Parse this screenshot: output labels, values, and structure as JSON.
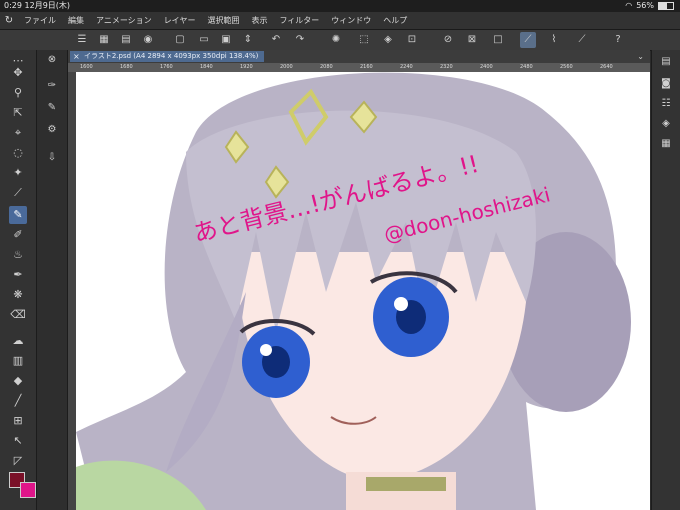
{
  "status": {
    "time": "0:29",
    "date": "12月9日(木)",
    "battery": "56%",
    "wifi_icon": "wifi-icon",
    "battery_icon": "battery-icon"
  },
  "menu": [
    "ファイル",
    "編集",
    "アニメーション",
    "レイヤー",
    "選択範囲",
    "表示",
    "フィルター",
    "ウィンドウ",
    "ヘルプ"
  ],
  "tab": {
    "title": "イラスト2.psd (A4 2894 x 4093px 350dpi 138.4%)"
  },
  "ruler": [
    "1600",
    "1680",
    "1760",
    "1840",
    "1920",
    "2000",
    "2080",
    "2160",
    "2240",
    "2320",
    "2400",
    "2480",
    "2560",
    "2640"
  ],
  "artwork": {
    "signature_line1": "あと背景…!がんばるよ。!!",
    "signature_line2": "@doon-hoshizaki"
  },
  "colors": {
    "main": "#7a1028",
    "sub": "#e0158a",
    "accent": "#4a6a9a"
  }
}
